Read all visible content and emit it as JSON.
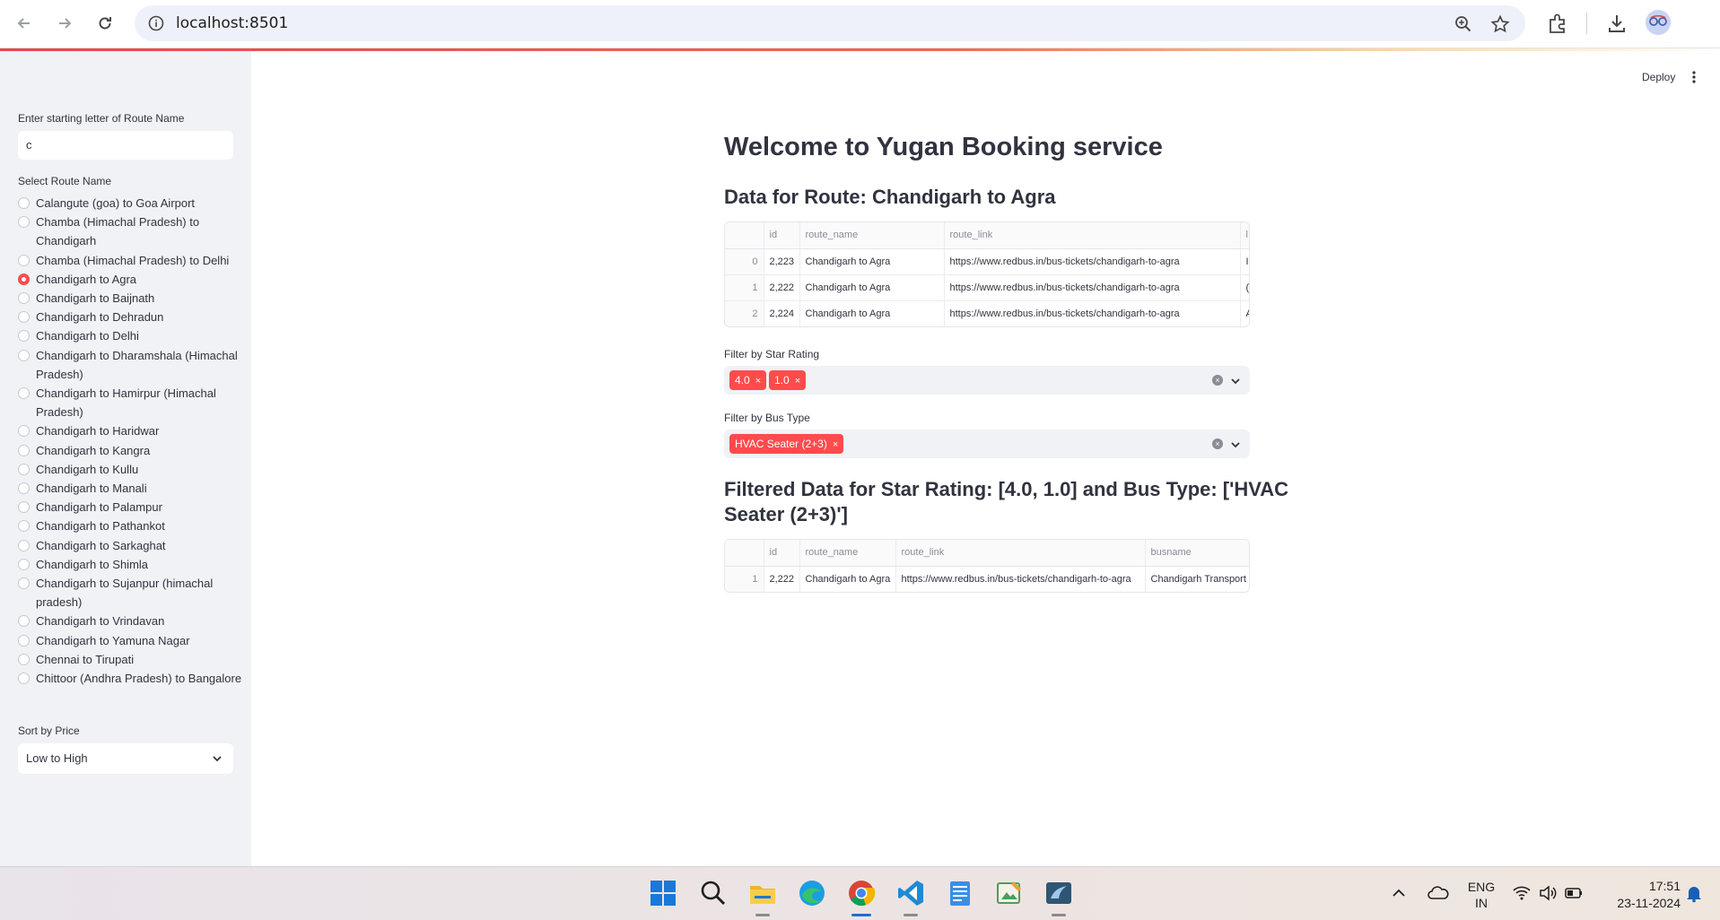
{
  "browser": {
    "url": "localhost:8501",
    "icons": [
      "back-icon",
      "forward-icon",
      "reload-icon",
      "site-info-icon",
      "zoom-icon",
      "star-icon",
      "extensions-icon",
      "download-icon",
      "avatar"
    ]
  },
  "sidebar": {
    "search_label": "Enter starting letter of Route Name",
    "search_value": "c",
    "route_label": "Select Route Name",
    "routes": [
      "Calangute (goa) to Goa Airport",
      "Chamba (Himachal Pradesh) to Chandigarh",
      "Chamba (Himachal Pradesh) to Delhi",
      "Chandigarh to Agra",
      "Chandigarh to Baijnath",
      "Chandigarh to Dehradun",
      "Chandigarh to Delhi",
      "Chandigarh to Dharamshala (Himachal Pradesh)",
      "Chandigarh to Hamirpur (Himachal Pradesh)",
      "Chandigarh to Haridwar",
      "Chandigarh to Kangra",
      "Chandigarh to Kullu",
      "Chandigarh to Manali",
      "Chandigarh to Palampur",
      "Chandigarh to Pathankot",
      "Chandigarh to Sarkaghat",
      "Chandigarh to Shimla",
      "Chandigarh to Sujanpur (himachal pradesh)",
      "Chandigarh to Vrindavan",
      "Chandigarh to Yamuna Nagar",
      "Chennai to Tirupati",
      "Chittoor (Andhra Pradesh) to Bangalore"
    ],
    "selected_index": 3,
    "sort_label": "Sort by Price",
    "sort_value": "Low to High"
  },
  "header": {
    "deploy_label": "Deploy"
  },
  "main": {
    "title": "Welcome to Yugan Booking service",
    "route_heading": "Data for Route: Chandigarh to Agra",
    "table1": {
      "columns": [
        "",
        "id",
        "route_name",
        "route_link",
        "l"
      ],
      "rows": [
        [
          "0",
          "2,223",
          "Chandigarh to Agra",
          "https://www.redbus.in/bus-tickets/chandigarh-to-agra",
          "I"
        ],
        [
          "1",
          "2,222",
          "Chandigarh to Agra",
          "https://www.redbus.in/bus-tickets/chandigarh-to-agra",
          "("
        ],
        [
          "2",
          "2,224",
          "Chandigarh to Agra",
          "https://www.redbus.in/bus-tickets/chandigarh-to-agra",
          "A"
        ]
      ]
    },
    "star_filter": {
      "label": "Filter by Star Rating",
      "tags": [
        "4.0",
        "1.0"
      ]
    },
    "bus_filter": {
      "label": "Filter by Bus Type",
      "tags": [
        "HVAC Seater (2+3)"
      ]
    },
    "filtered_heading_line1": "Filtered Data for Star Rating: [4.0, 1.0] and Bus Type: ['HVAC",
    "filtered_heading_line2": "Seater (2+3)']",
    "table2": {
      "columns": [
        "",
        "id",
        "route_name",
        "route_link",
        "busname"
      ],
      "rows": [
        [
          "1",
          "2,222",
          "Chandigarh to Agra",
          "https://www.redbus.in/bus-tickets/chandigarh-to-agra",
          "Chandigarh Transport"
        ]
      ]
    }
  },
  "taskbar": {
    "apps": [
      "windows-start-icon",
      "search-icon",
      "file-explorer-icon",
      "edge-icon",
      "chrome-icon",
      "vscode-icon",
      "notepad-icon",
      "paint-icon",
      "app-icon"
    ],
    "tray_lang_line1": "ENG",
    "tray_lang_line2": "IN",
    "time": "17:51",
    "date": "23-11-2024"
  },
  "colors": {
    "accent": "#ff4b4b",
    "sidebar_bg": "#f0f2f6",
    "text": "#31333f"
  }
}
